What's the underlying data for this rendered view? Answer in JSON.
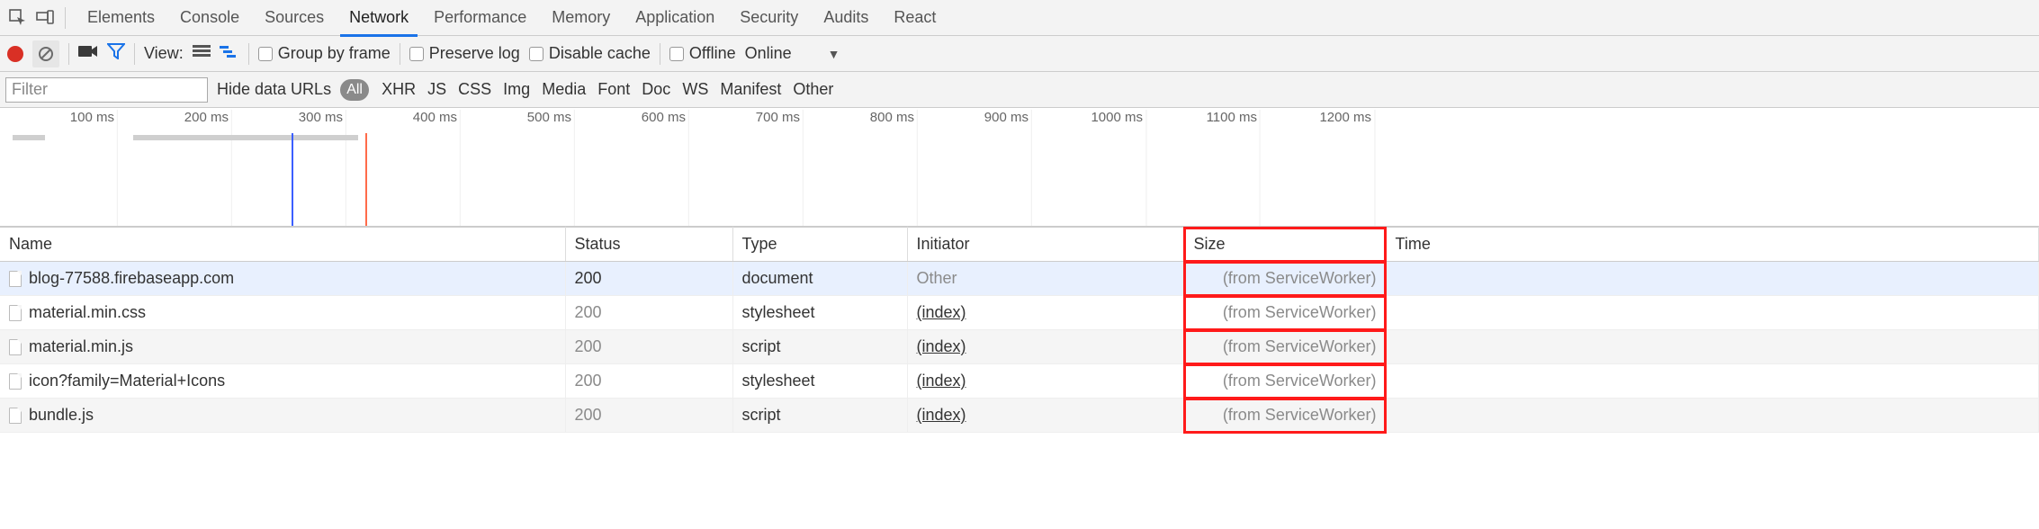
{
  "tabs": [
    "Elements",
    "Console",
    "Sources",
    "Network",
    "Performance",
    "Memory",
    "Application",
    "Security",
    "Audits",
    "React"
  ],
  "active_tab": "Network",
  "toolbar": {
    "view_label": "View:",
    "group_by_frame": "Group by frame",
    "preserve_log": "Preserve log",
    "disable_cache": "Disable cache",
    "offline": "Offline",
    "online": "Online"
  },
  "filterrow": {
    "placeholder": "Filter",
    "hide_data_urls": "Hide data URLs",
    "all_pill": "All",
    "types": [
      "XHR",
      "JS",
      "CSS",
      "Img",
      "Media",
      "Font",
      "Doc",
      "WS",
      "Manifest",
      "Other"
    ]
  },
  "timeline": {
    "ticks": [
      "100 ms",
      "200 ms",
      "300 ms",
      "400 ms",
      "500 ms",
      "600 ms",
      "700 ms",
      "800 ms",
      "900 ms",
      "1000 ms",
      "1100 ms",
      "1200 ms"
    ]
  },
  "columns": {
    "name": "Name",
    "status": "Status",
    "type": "Type",
    "init": "Initiator",
    "size": "Size",
    "time": "Time"
  },
  "rows": [
    {
      "name": "blog-77588.firebaseapp.com",
      "status": "200",
      "status_dim": false,
      "type": "document",
      "init": "Other",
      "init_link": false,
      "size": "(from ServiceWorker)",
      "selected": true
    },
    {
      "name": "material.min.css",
      "status": "200",
      "status_dim": true,
      "type": "stylesheet",
      "init": "(index)",
      "init_link": true,
      "size": "(from ServiceWorker)",
      "selected": false
    },
    {
      "name": "material.min.js",
      "status": "200",
      "status_dim": true,
      "type": "script",
      "init": "(index)",
      "init_link": true,
      "size": "(from ServiceWorker)",
      "selected": false
    },
    {
      "name": "icon?family=Material+Icons",
      "status": "200",
      "status_dim": true,
      "type": "stylesheet",
      "init": "(index)",
      "init_link": true,
      "size": "(from ServiceWorker)",
      "selected": false
    },
    {
      "name": "bundle.js",
      "status": "200",
      "status_dim": true,
      "type": "script",
      "init": "(index)",
      "init_link": true,
      "size": "(from ServiceWorker)",
      "selected": false
    }
  ]
}
